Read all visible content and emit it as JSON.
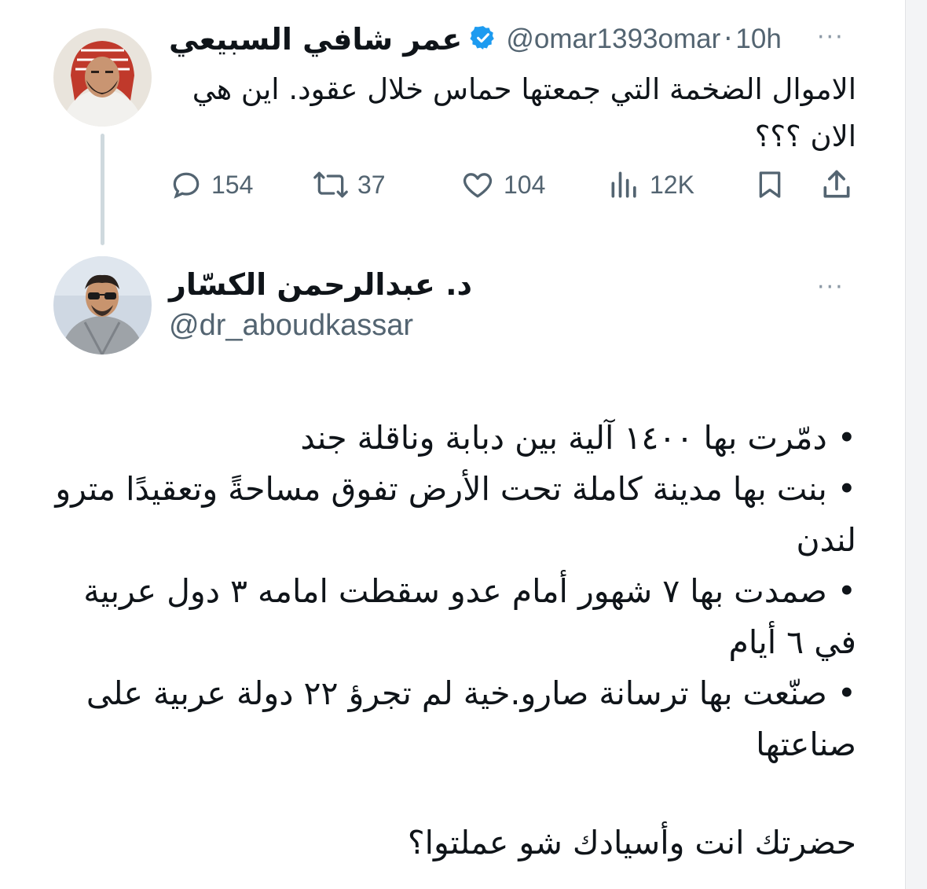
{
  "tweet": {
    "author_name": "عمر شافي السبيعي",
    "handle": "@omar1393omar",
    "separator": "·",
    "time": "10h",
    "more": "···",
    "text": "الاموال الضخمة التي جمعتها حماس خلال عقود. اين هي الان ؟؟؟",
    "stats": {
      "replies": "154",
      "retweets": "37",
      "likes": "104",
      "views": "12K"
    }
  },
  "reply": {
    "author_name": "د. عبدالرحمن الكسّار",
    "handle": "@dr_aboudkassar",
    "more": "···",
    "bullets": [
      "• دمّرت بها ١٤٠٠ آلية بين دبابة وناقلة جند",
      "• بنت بها مدينة كاملة تحت الأرض تفوق مساحةً وتعقيدًا مترو لندن",
      "• صمدت بها ٧ شهور أمام عدو سقطت امامه ٣ دول عربية في ٦ أيام",
      "• صنّعت بها ترسانة صارو.خية لم تجرؤ ٢٢ دولة عربية على صناعتها"
    ],
    "closing": "حضرتك انت وأسيادك شو عملتوا؟"
  },
  "colors": {
    "verified": "#1d9bf0",
    "muted": "#536471",
    "thread_line": "#cfd9de"
  }
}
